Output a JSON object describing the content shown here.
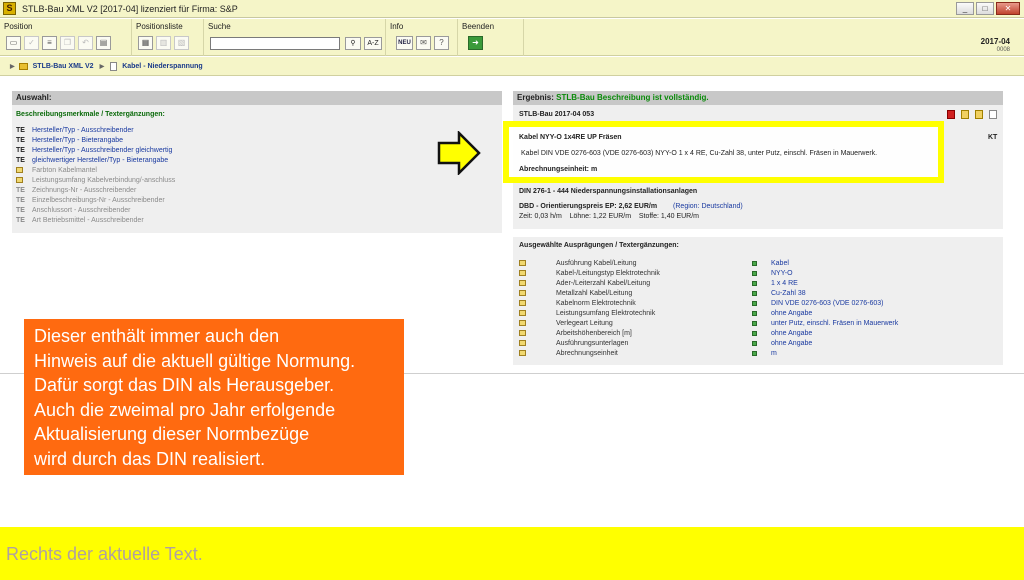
{
  "window": {
    "app_icon_letter": "S",
    "title": "STLB-Bau XML V2 [2017-04] lizenziert für Firma: S&P",
    "min_label": "_",
    "max_label": "□",
    "close_label": "✕"
  },
  "toolbar": {
    "groups": {
      "position": "Position",
      "positionsliste": "Positionsliste",
      "suche": "Suche",
      "info": "Info",
      "beenden": "Beenden"
    },
    "search_value": "",
    "search_binoculars": "⌘",
    "search_az": "A-Z",
    "neu_label": "NEU",
    "help_label": "?",
    "version": "2017-04",
    "build": "0008"
  },
  "breadcrumb": {
    "root": "STLB-Bau XML V2",
    "current": "Kabel - Niederspannung"
  },
  "left_panel": {
    "header": "Auswahl:",
    "subtitle": "Beschreibungsmerkmale / Textergänzungen:",
    "items": [
      {
        "code": "TE",
        "label": "Hersteller/Typ - Ausschreibender"
      },
      {
        "code": "TE",
        "label": "Hersteller/Typ - Bieterangabe"
      },
      {
        "code": "TE",
        "label": "Hersteller/Typ - Ausschreibender gleichwertig"
      },
      {
        "code": "TE",
        "label": "gleichwertiger Hersteller/Typ - Bieterangabe"
      },
      {
        "code": "",
        "label": "Farbton Kabelmantel"
      },
      {
        "code": "",
        "label": "Leistungsumfang Kabelverbindung/-anschluss"
      },
      {
        "code": "TE",
        "label": "Zeichnungs-Nr - Ausschreibender"
      },
      {
        "code": "TE",
        "label": "Einzelbeschreibungs-Nr - Ausschreibender"
      },
      {
        "code": "TE",
        "label": "Anschlussort - Ausschreibender"
      },
      {
        "code": "TE",
        "label": "Art Betriebsmittel - Ausschreibender"
      }
    ]
  },
  "right_panel": {
    "header_label": "Ergebnis:",
    "header_status": "STLB-Bau Beschreibung ist vollständig.",
    "stlb_id": "STLB-Bau 2017-04 053",
    "kt": "KT",
    "short_text": "Kabel NYY-O 1x4RE UP Fräsen",
    "long_text": "Kabel DIN VDE 0276-603 (VDE 0276-603) NYY-O 1 x 4 RE, Cu-Zahl 38, unter Putz, einschl. Fräsen in Mauerwerk.",
    "unit_line": "Abrechnungseinheit: m",
    "din_line": "DIN 276-1 - 444 Niederspannungsinstallationsanlagen",
    "price_line": "DBD - Orientierungspreis EP: 2,62 EUR/m",
    "region": "(Region: Deutschland)",
    "time_line": "Zeit: 0,03 h/m    Löhne: 1,22 EUR/m    Stoffe: 1,40 EUR/m",
    "selected_header": "Ausgewählte Ausprägungen / Textergänzungen:",
    "selected": [
      {
        "name": "Ausführung Kabel/Leitung",
        "value": "Kabel"
      },
      {
        "name": "Kabel-/Leitungstyp Elektrotechnik",
        "value": "NYY-O"
      },
      {
        "name": "Ader-/Leiterzahl Kabel/Leitung",
        "value": "1 x 4 RE"
      },
      {
        "name": "Metallzahl Kabel/Leitung",
        "value": "Cu-Zahl 38"
      },
      {
        "name": "Kabelnorm Elektrotechnik",
        "value": "DIN VDE 0276-603 (VDE 0276-603)"
      },
      {
        "name": "Leistungsumfang Elektrotechnik",
        "value": "ohne Angabe"
      },
      {
        "name": "Verlegeart Leitung",
        "value": "unter Putz, einschl. Fräsen in Mauerwerk"
      },
      {
        "name": "Arbeitshöhenbereich [m]",
        "value": "ohne Angabe"
      },
      {
        "name": "Ausführungsunterlagen",
        "value": "ohne Angabe"
      },
      {
        "name": "Abrechnungseinheit",
        "value": "m"
      }
    ]
  },
  "callout": {
    "lines": [
      "Dieser enthält immer auch den",
      "Hinweis auf die aktuell gültige Normung.",
      "Dafür sorgt das DIN als Herausgeber.",
      "Auch die zweimal pro Jahr erfolgende",
      "Aktualisierung dieser Normbezüge",
      "wird durch das DIN realisiert."
    ]
  },
  "footer": {
    "text": "Rechts der aktuelle Text."
  },
  "colors": {
    "chrome": "#f5f5c8",
    "highlight": "#ffff00",
    "callout": "#ff6a10",
    "status_green": "#0a8a0a",
    "link_blue": "#1a3aa0"
  }
}
